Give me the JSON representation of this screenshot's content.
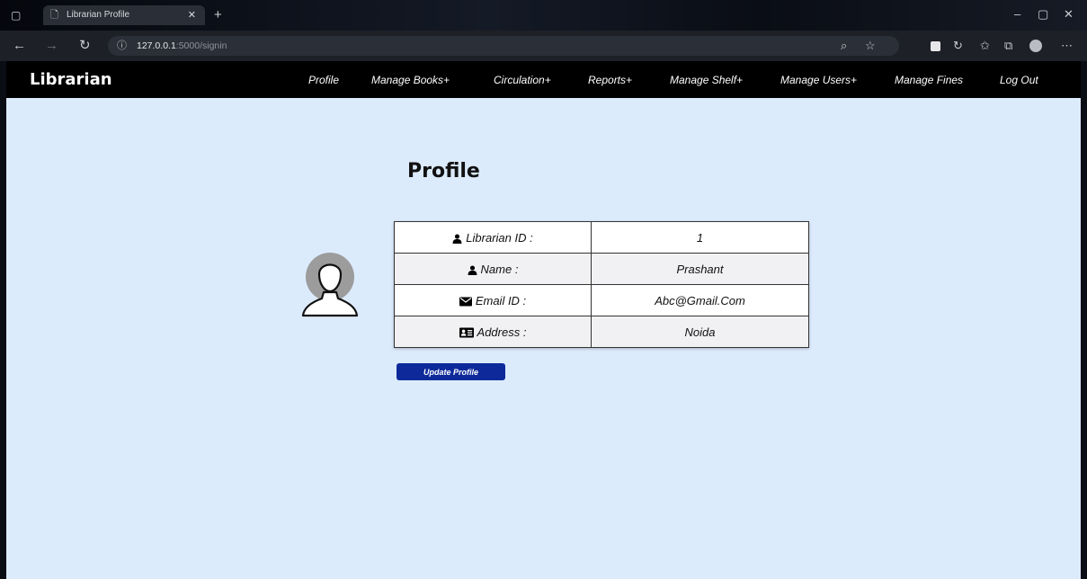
{
  "browser": {
    "tab_title": "Librarian Profile",
    "url_host": "127.0.0.1",
    "url_path": ":5000/signin"
  },
  "navbar": {
    "brand": "Librarian",
    "links": [
      "Profile",
      "Manage Books+",
      "Circulation+",
      "Reports+",
      "Manage Shelf+",
      "Manage Users+",
      "Manage Fines",
      "Log Out"
    ]
  },
  "profile": {
    "heading": "Profile",
    "rows": [
      {
        "icon": "user-icon",
        "label": "Librarian ID :",
        "value": "1"
      },
      {
        "icon": "user-icon",
        "label": "Name :",
        "value": "Prashant"
      },
      {
        "icon": "envelope-icon",
        "label": "Email ID :",
        "value": "Abc@Gmail.Com"
      },
      {
        "icon": "address-card-icon",
        "label": "Address :",
        "value": "Noida"
      }
    ],
    "update_button": "Update Profile"
  },
  "colors": {
    "page_bg": "#dcebfc",
    "navbar_bg": "#000000",
    "button_bg": "#0e2a9a"
  }
}
